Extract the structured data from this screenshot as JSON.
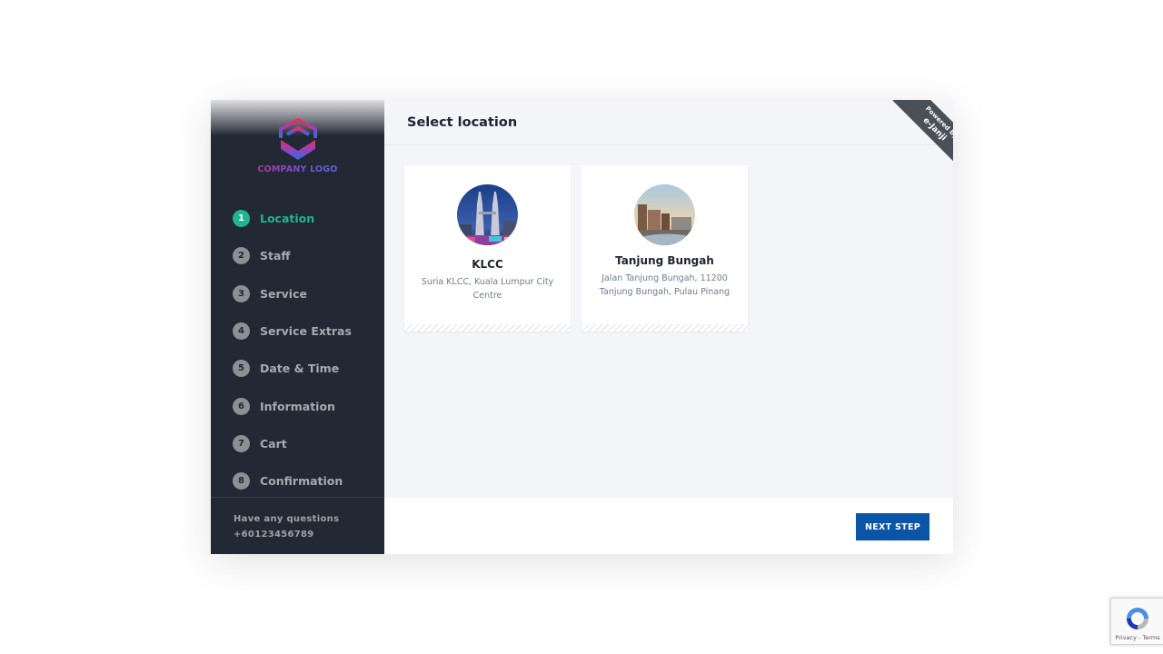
{
  "sidebar": {
    "logo_text": "COMPANY LOGO",
    "steps": [
      {
        "num": "1",
        "label": "Location",
        "active": true
      },
      {
        "num": "2",
        "label": "Staff"
      },
      {
        "num": "3",
        "label": "Service"
      },
      {
        "num": "4",
        "label": "Service Extras"
      },
      {
        "num": "5",
        "label": "Date & Time"
      },
      {
        "num": "6",
        "label": "Information"
      },
      {
        "num": "7",
        "label": "Cart"
      },
      {
        "num": "8",
        "label": "Confirmation"
      }
    ],
    "footer": {
      "question": "Have any questions",
      "phone": "+60123456789"
    }
  },
  "main": {
    "title": "Select location",
    "locations": [
      {
        "name": "KLCC",
        "address": "Suria KLCC, Kuala Lumpur City Centre",
        "image_icon": "klcc-towers-photo"
      },
      {
        "name": "Tanjung Bungah",
        "address": "Jalan Tanjung Bungah, 11200 Tanjung Bungah, Pulau Pinang",
        "image_icon": "seaside-city-photo"
      }
    ],
    "next_button": "NEXT STEP"
  },
  "ribbon": {
    "line1": "Powered by",
    "line2": "e-Janji"
  },
  "recaptcha": {
    "links": "Privacy - Terms"
  },
  "colors": {
    "accent": "#1fb493",
    "primary_button": "#0b55a8",
    "sidebar_bg": "#222834"
  }
}
